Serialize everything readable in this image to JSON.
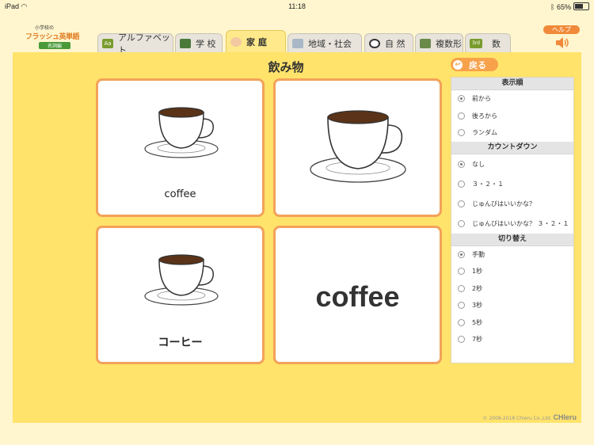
{
  "status_bar": {
    "device": "iPad",
    "time": "11:18",
    "battery": "65%"
  },
  "app": {
    "logo_line1": "小学校の",
    "logo_main": "フラッシュ英単語",
    "logo_sub": "名詞編"
  },
  "tabs": [
    {
      "label": "アルファベット",
      "icon": "Aa",
      "color": "#7A9C2E",
      "active": false
    },
    {
      "label": "学 校",
      "icon": "",
      "color": "#4A7A3A",
      "active": false
    },
    {
      "label": "家 庭",
      "icon": "",
      "color": "#D9A36A",
      "active": true
    },
    {
      "label": "地域・社会",
      "icon": "",
      "color": "#8AA0B5",
      "active": false
    },
    {
      "label": "自 然",
      "icon": "",
      "color": "#444444",
      "active": false
    },
    {
      "label": "複数形",
      "icon": "",
      "color": "#6A8A4A",
      "active": false
    },
    {
      "label": "数",
      "icon": "3rd",
      "color": "#7A9C2E",
      "active": false
    }
  ],
  "help": {
    "label": "ヘルプ"
  },
  "topic": {
    "title": "飲み物",
    "back_label": "戻る"
  },
  "cards": {
    "word_label": "coffee",
    "kana_label": "コーヒー",
    "big_word": "coffee"
  },
  "sidebar": {
    "order": {
      "header": "表示順",
      "options": [
        "前から",
        "後ろから",
        "ランダム"
      ],
      "selected": 0
    },
    "countdown": {
      "header": "カウントダウン",
      "options": [
        "なし",
        "３・２・１",
        "じゅんびはいいかな？",
        "じゅんびはいいかな？ ３・２・１"
      ],
      "selected": 0
    },
    "switch": {
      "header": "切り替え",
      "options": [
        "手動",
        "1秒",
        "2秒",
        "3秒",
        "5秒",
        "7秒"
      ],
      "selected": 0
    }
  },
  "footer": {
    "copyright": "© 2008-2018 Chieru Co.,Ltd.",
    "brand": "CHIeru"
  },
  "colors": {
    "panel": "#FFE36A",
    "card_border": "#F4A25B",
    "accent": "#F08A3A"
  }
}
